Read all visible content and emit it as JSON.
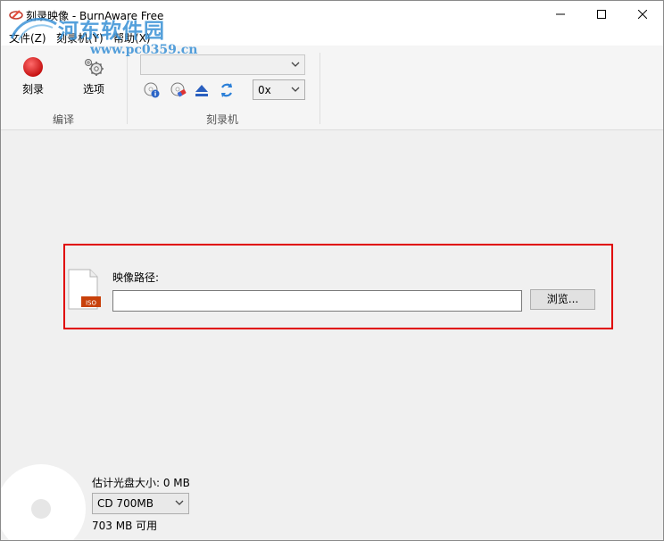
{
  "window": {
    "title": "刻录映像 - BurnAware Free"
  },
  "watermark": {
    "name": "河东软件园",
    "url": "www.pc0359.cn"
  },
  "menu": {
    "file": "文件(Z)",
    "burner": "刻录机(Y)",
    "help": "帮助(X)"
  },
  "toolbar": {
    "burn_label": "刻录",
    "options_label": "选项",
    "group_edit": "编译",
    "group_burner": "刻录机",
    "drive_value": "",
    "speed_value": "0x"
  },
  "main": {
    "path_label": "映像路径:",
    "path_value": "",
    "browse_label": "浏览...",
    "iso_badge": "ISO"
  },
  "footer": {
    "estimate_label": "估计光盘大小: 0 MB",
    "disc_type": "CD 700MB",
    "available_label": "703 MB 可用"
  },
  "colors": {
    "highlight_border": "#e00000",
    "watermark_blue": "#3d93d7",
    "burn_button_red": "#e11b1b"
  }
}
